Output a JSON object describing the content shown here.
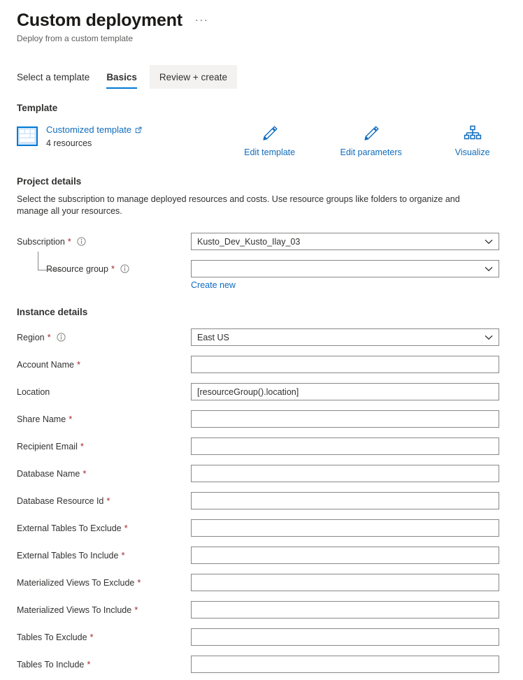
{
  "header": {
    "title": "Custom deployment",
    "subtitle": "Deploy from a custom template",
    "more_label": "···"
  },
  "tabs": [
    {
      "label": "Select a template",
      "state": "inactive"
    },
    {
      "label": "Basics",
      "state": "active"
    },
    {
      "label": "Review + create",
      "state": "hovered"
    }
  ],
  "template_section": {
    "heading": "Template",
    "link_label": "Customized template",
    "resource_count": "4 resources",
    "actions": [
      {
        "label": "Edit template",
        "icon": "pencil-icon"
      },
      {
        "label": "Edit parameters",
        "icon": "pencil-icon"
      },
      {
        "label": "Visualize",
        "icon": "hierarchy-icon"
      }
    ]
  },
  "project_details": {
    "heading": "Project details",
    "description": "Select the subscription to manage deployed resources and costs. Use resource groups like folders to organize and manage all your resources.",
    "subscription": {
      "label": "Subscription",
      "required": "*",
      "value": "Kusto_Dev_Kusto_Ilay_03"
    },
    "resource_group": {
      "label": "Resource group",
      "required": "*",
      "value": "",
      "create_new_label": "Create new"
    }
  },
  "instance_details": {
    "heading": "Instance details",
    "fields": [
      {
        "label": "Region",
        "required": "*",
        "value": "East US",
        "type": "dropdown",
        "info": true,
        "name": "region"
      },
      {
        "label": "Account Name",
        "required": "*",
        "value": "",
        "type": "text",
        "info": false,
        "name": "account-name"
      },
      {
        "label": "Location",
        "required": "",
        "value": "[resourceGroup().location]",
        "type": "text",
        "info": false,
        "name": "location"
      },
      {
        "label": "Share Name",
        "required": "*",
        "value": "",
        "type": "text",
        "info": false,
        "name": "share-name"
      },
      {
        "label": "Recipient Email",
        "required": "*",
        "value": "",
        "type": "text",
        "info": false,
        "name": "recipient-email"
      },
      {
        "label": "Database Name",
        "required": "*",
        "value": "",
        "type": "text",
        "info": false,
        "name": "database-name"
      },
      {
        "label": "Database Resource Id",
        "required": "*",
        "value": "",
        "type": "text",
        "info": false,
        "name": "database-resource-id"
      },
      {
        "label": "External Tables To Exclude",
        "required": "*",
        "value": "",
        "type": "text",
        "info": false,
        "name": "external-tables-to-exclude"
      },
      {
        "label": "External Tables To Include",
        "required": "*",
        "value": "",
        "type": "text",
        "info": false,
        "name": "external-tables-to-include"
      },
      {
        "label": "Materialized Views To Exclude",
        "required": "*",
        "value": "",
        "type": "text",
        "info": false,
        "name": "materialized-views-to-exclude"
      },
      {
        "label": "Materialized Views To Include",
        "required": "*",
        "value": "",
        "type": "text",
        "info": false,
        "name": "materialized-views-to-include"
      },
      {
        "label": "Tables To Exclude",
        "required": "*",
        "value": "",
        "type": "text",
        "info": false,
        "name": "tables-to-exclude"
      },
      {
        "label": "Tables To Include",
        "required": "*",
        "value": "",
        "type": "text",
        "info": false,
        "name": "tables-to-include"
      }
    ]
  },
  "colors": {
    "accent": "#0078d4",
    "link": "#0f6cbd",
    "required": "#a4262c",
    "text": "#323130",
    "border": "#8a8886"
  }
}
